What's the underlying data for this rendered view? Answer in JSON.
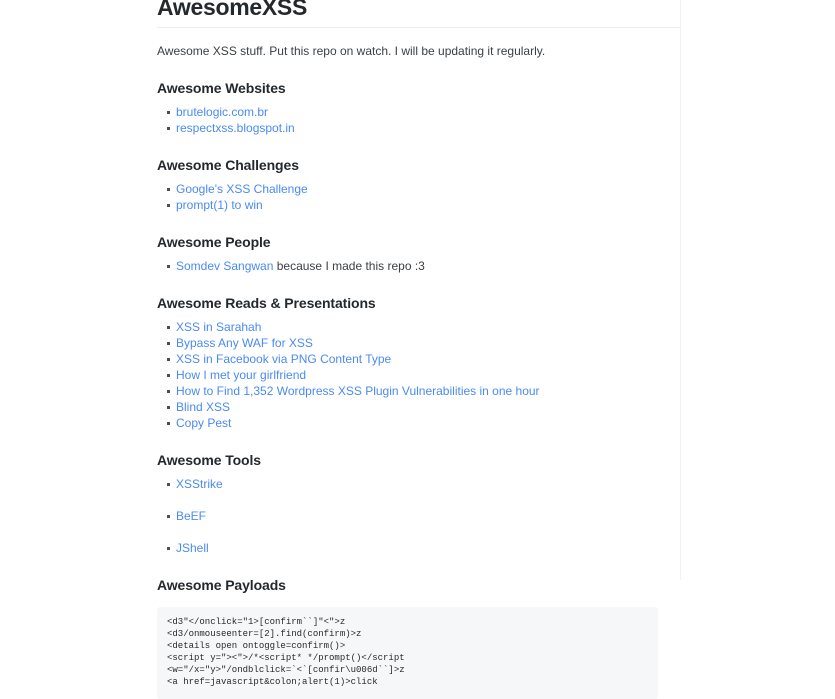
{
  "document": {
    "title": "AwesomeXSS",
    "intro": "Awesome XSS stuff. Put this repo on watch. I will be updating it regularly."
  },
  "sections": {
    "websites": {
      "heading": "Awesome Websites",
      "items": [
        {
          "label": "brutelogic.com.br"
        },
        {
          "label": "respectxss.blogspot.in"
        }
      ]
    },
    "challenges": {
      "heading": "Awesome Challenges",
      "items": [
        {
          "label": "Google's XSS Challenge"
        },
        {
          "label": "prompt(1) to win"
        }
      ]
    },
    "people": {
      "heading": "Awesome People",
      "items": [
        {
          "label": "Somdev Sangwan",
          "note": " because I made this repo :3"
        }
      ]
    },
    "reads": {
      "heading": "Awesome Reads & Presentations",
      "items": [
        {
          "label": "XSS in Sarahah"
        },
        {
          "label": "Bypass Any WAF for XSS"
        },
        {
          "label": "XSS in Facebook via PNG Content Type"
        },
        {
          "label": "How I met your girlfriend"
        },
        {
          "label": "How to Find 1,352 Wordpress XSS Plugin Vulnerabilities in one hour"
        },
        {
          "label": "Blind XSS"
        },
        {
          "label": "Copy Pest"
        }
      ]
    },
    "tools": {
      "heading": "Awesome Tools",
      "items": [
        {
          "label": "XSStrike"
        },
        {
          "label": "BeEF"
        },
        {
          "label": "JShell"
        }
      ]
    },
    "payloads": {
      "heading": "Awesome Payloads",
      "code": "<d3\"</onclick=\"1>[confirm``]\"<\">z\n<d3/onmouseenter=[2].find(confirm)>z\n<details open ontoggle=confirm()>\n<script y=\"><\">/*<script* */prompt()</script\n<w=\"/x=\"y>\"/ondblclick=`<`[confir\\u006d``]>z\n<a href=javascript&colon;alert(1)>click"
    }
  },
  "colors": {
    "link": "#4a8af4",
    "heading": "#24292e",
    "body_text": "#3b4045",
    "code_background": "#f6f7f9",
    "rule": "#eaecef",
    "page_background": "#ffffff"
  }
}
